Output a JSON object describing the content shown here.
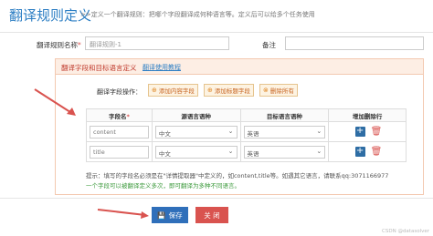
{
  "header": {
    "title": "翻译规则定义",
    "description": ">>定义一个翻译规则：把哪个字段翻译成何种语言等。定义后可以给多个任务使用"
  },
  "form": {
    "rule_name_label": "翻译规则名称",
    "required_mark": "*",
    "rule_name_value": "翻译规则-1",
    "remark_label": "备注",
    "remark_value": ""
  },
  "panel": {
    "title": "翻译字段和目标语言定义",
    "tutorial_link": "翻译使用教程",
    "operation_label": "翻译字段操作：",
    "buttons": {
      "add_content": "添加内容字段",
      "add_title": "添加标题字段",
      "delete_all": "删除所有"
    },
    "columns": [
      "字段名",
      "源语言语种",
      "目标语言语种",
      "增加删除行"
    ],
    "rows": [
      {
        "field": "content",
        "source_lang": "中文",
        "target_lang": "英语"
      },
      {
        "field": "title",
        "source_lang": "中文",
        "target_lang": "英语"
      }
    ],
    "tip": "提示：填写的字段名必须是在\"详情提取器\"中定义的，如content,title等。如遇其它语言，请联系qq:3071166977",
    "tip2": "一个字段可以被翻译定义多次，即可翻译为多种不同语言。"
  },
  "actions": {
    "save": "保存",
    "close": "关 闭"
  },
  "watermark": "CSDN @datasolver",
  "colors": {
    "title": "#2e7fc4",
    "save": "#2f6fba",
    "close": "#d9534f",
    "panel_title": "#c0392b",
    "tip2": "#3c9a3c"
  }
}
